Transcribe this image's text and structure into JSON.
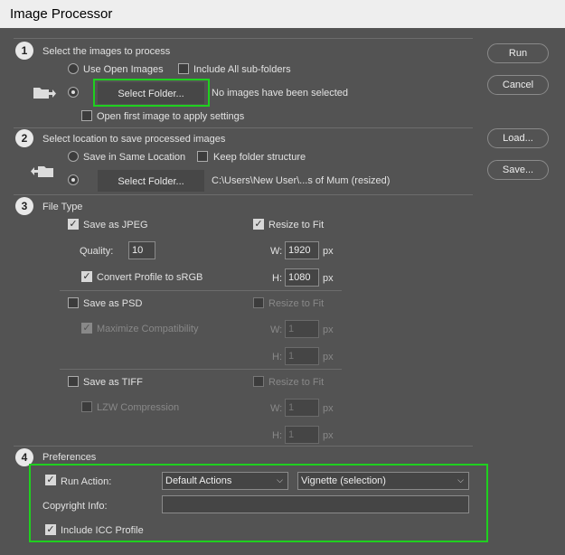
{
  "window": {
    "title": "Image Processor"
  },
  "buttons": {
    "run": "Run",
    "cancel": "Cancel",
    "load": "Load...",
    "save": "Save..."
  },
  "section1": {
    "number": "1",
    "heading": "Select the images to process",
    "use_open_images": "Use Open Images",
    "include_subfolders": "Include All sub-folders",
    "select_folder": "Select Folder...",
    "status": "No images have been selected",
    "open_first": "Open first image to apply settings"
  },
  "section2": {
    "number": "2",
    "heading": "Select location to save processed images",
    "save_same": "Save in Same Location",
    "keep_structure": "Keep folder structure",
    "select_folder": "Select Folder...",
    "path": "C:\\Users\\New User\\...s of Mum (resized)"
  },
  "section3": {
    "number": "3",
    "heading": "File Type",
    "jpeg": {
      "save_label": "Save as JPEG",
      "resize_label": "Resize to Fit",
      "quality_label": "Quality:",
      "quality_value": "10",
      "w_label": "W:",
      "w_value": "1920",
      "w_unit": "px",
      "h_label": "H:",
      "h_value": "1080",
      "h_unit": "px",
      "convert_label": "Convert Profile to sRGB"
    },
    "psd": {
      "save_label": "Save as PSD",
      "resize_label": "Resize to Fit",
      "max_compat_label": "Maximize Compatibility",
      "w_label": "W:",
      "w_value": "1",
      "w_unit": "px",
      "h_label": "H:",
      "h_value": "1",
      "h_unit": "px"
    },
    "tiff": {
      "save_label": "Save as TIFF",
      "resize_label": "Resize to Fit",
      "lzw_label": "LZW Compression",
      "w_label": "W:",
      "w_value": "1",
      "w_unit": "px",
      "h_label": "H:",
      "h_value": "1",
      "h_unit": "px"
    }
  },
  "section4": {
    "number": "4",
    "heading": "Preferences",
    "run_action_label": "Run Action:",
    "action_set": "Default Actions",
    "action_name": "Vignette (selection)",
    "copyright_label": "Copyright Info:",
    "copyright_value": "",
    "icc_label": "Include ICC Profile"
  },
  "colors": {
    "background": "#535353",
    "highlight": "#1fd01f",
    "titlebar": "#eeeeee"
  }
}
